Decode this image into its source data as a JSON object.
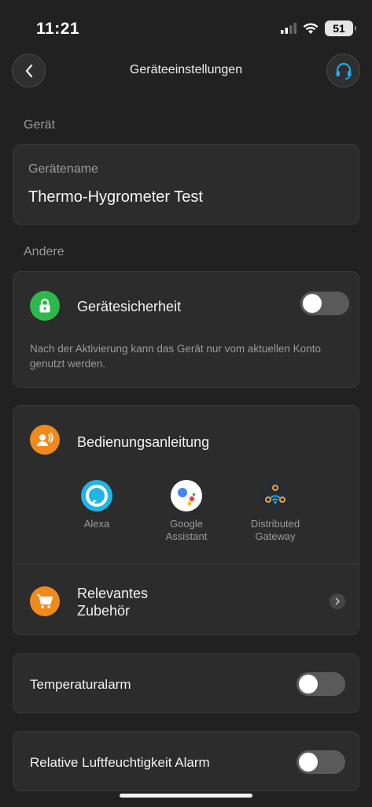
{
  "status": {
    "time": "11:21",
    "battery": "51"
  },
  "header": {
    "title": "Geräteeinstellungen"
  },
  "sections": {
    "device": "Gerät",
    "other": "Andere"
  },
  "device_name": {
    "caption": "Gerätename",
    "value": "Thermo-Hygrometer Test"
  },
  "security": {
    "label": "Gerätesicherheit",
    "enabled": false,
    "description": "Nach der Aktivierung kann das Gerät nur vom aktuellen Konto genutzt werden."
  },
  "manual": {
    "label": "Bedienungsanleitung",
    "assistants": [
      {
        "label": "Alexa",
        "icon": "alexa-logo"
      },
      {
        "label": "Google\nAssistant",
        "icon": "google-assistant-logo"
      },
      {
        "label": "Distributed\nGateway",
        "icon": "distributed-gateway-logo"
      }
    ]
  },
  "accessories": {
    "label": "Relevantes\nZubehör"
  },
  "temperature_alarm": {
    "label": "Temperaturalarm",
    "enabled": false
  },
  "humidity_alarm": {
    "label": "Relative Luftfeuchtigkeit Alarm",
    "enabled": false
  },
  "colors": {
    "green": "#2db84d",
    "orange": "#f08a1c",
    "alexa": "#1fb5e6",
    "background": "#212121",
    "card": "#2c2c2c"
  }
}
